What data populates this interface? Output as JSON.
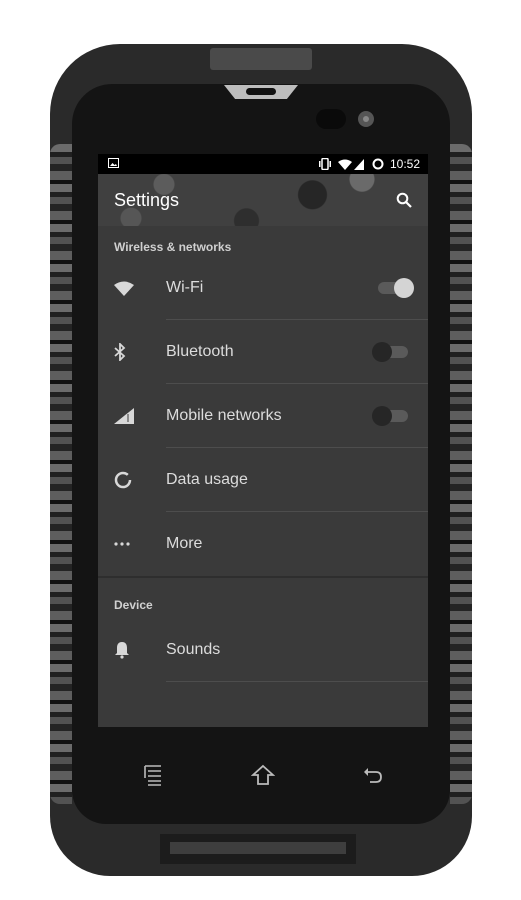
{
  "statusbar": {
    "notification_icon": "image-icon",
    "icons": [
      "vibrate-icon",
      "wifi-icon",
      "cell-signal-icon",
      "battery-ring-icon"
    ],
    "time": "10:52"
  },
  "appbar": {
    "title": "Settings",
    "search_icon": "search-icon"
  },
  "sections": [
    {
      "header": "Wireless & networks",
      "items": [
        {
          "label": "Wi-Fi",
          "icon": "wifi-icon",
          "toggle": "on"
        },
        {
          "label": "Bluetooth",
          "icon": "bluetooth-icon",
          "toggle": "off"
        },
        {
          "label": "Mobile networks",
          "icon": "cell-signal-icon",
          "toggle": "off"
        },
        {
          "label": "Data usage",
          "icon": "data-usage-icon"
        },
        {
          "label": "More",
          "icon": "more-icon"
        }
      ]
    },
    {
      "header": "Device",
      "items": [
        {
          "label": "Sounds",
          "icon": "bell-icon"
        }
      ]
    }
  ],
  "navbar": {
    "buttons": [
      "menu",
      "home",
      "back"
    ]
  }
}
